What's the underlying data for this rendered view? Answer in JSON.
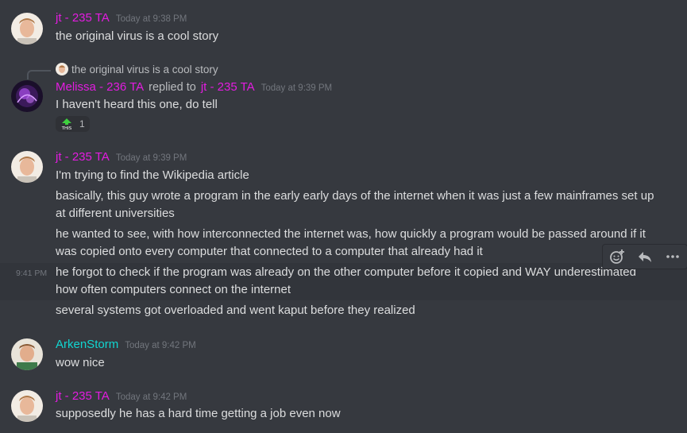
{
  "messages": [
    {
      "author": "jt - 235 TA",
      "timestamp": "Today at 9:38 PM",
      "lines": [
        "the original virus is a cool story"
      ]
    },
    {
      "reply_preview": "the original virus is a cool story",
      "author": "Melissa - 236 TA",
      "replied_label": "replied to",
      "replied_to": "jt - 235 TA",
      "timestamp": "Today at 9:39 PM",
      "lines": [
        "I haven't heard this one, do tell"
      ],
      "reaction": {
        "emoji": "this-emoji",
        "count": "1"
      }
    },
    {
      "author": "jt - 235 TA",
      "timestamp": "Today at 9:39 PM",
      "lines": [
        "I'm trying to find the Wikipedia article",
        "basically, this guy wrote a program in the early early days of the internet when it was just a few mainframes set up at different universities",
        "he wanted to see, with how interconnected the internet was, how quickly a program would be passed around if it was copied onto every computer that connected to a computer that already had it",
        "he forgot to check if the program was already on the other computer before it copied and WAY underestimated how often computers connect on the internet",
        "several systems got overloaded and went kaput before they realized"
      ],
      "hover_timestamp": "9:41 PM"
    },
    {
      "author": "ArkenStorm",
      "timestamp": "Today at 9:42 PM",
      "lines": [
        "wow nice"
      ]
    },
    {
      "author": "jt - 235 TA",
      "timestamp": "Today at 9:42 PM",
      "lines": [
        "supposedly he has a hard time getting a job even now"
      ]
    }
  ],
  "toolbar": {
    "icons": [
      "add-reaction-icon",
      "reply-icon",
      "more-icon"
    ]
  },
  "colors": {
    "background": "#36393f",
    "ta_role": "#e31ce0",
    "arken": "#11d6d1",
    "text": "#dcddde",
    "muted": "#72767d"
  }
}
